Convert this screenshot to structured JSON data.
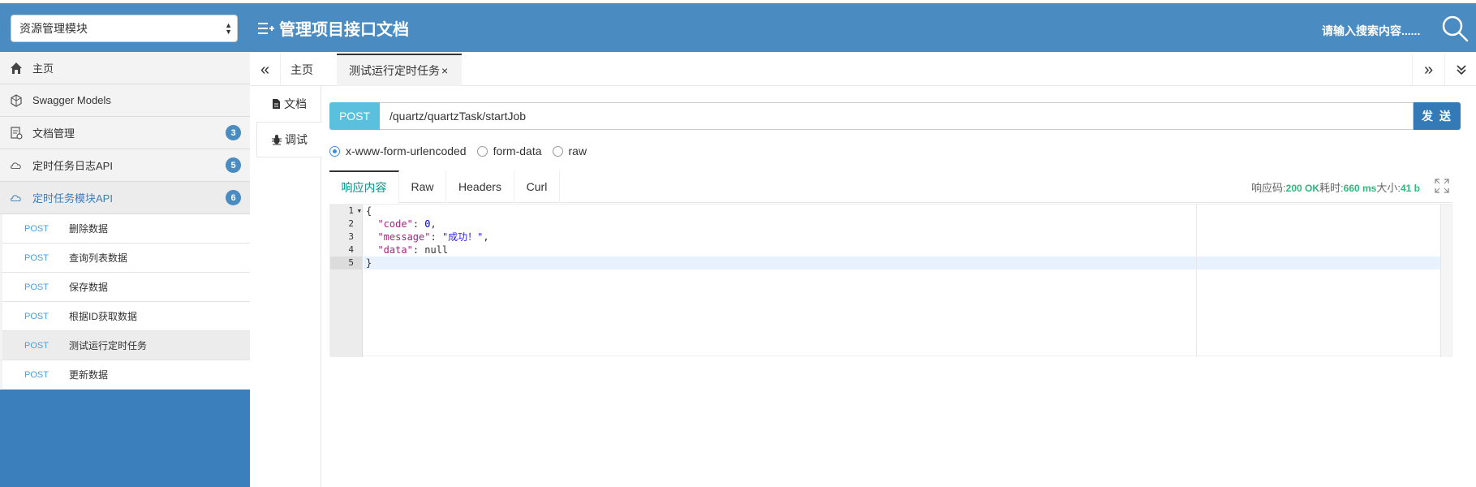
{
  "header": {
    "module_select": "资源管理模块",
    "title": "管理项目接口文档",
    "search_placeholder": "请输入搜索内容......",
    "bg_color": "#4a8bc2"
  },
  "sidebar": {
    "items": [
      {
        "label": "主页",
        "icon": "home-icon"
      },
      {
        "label": "Swagger Models",
        "icon": "models-icon"
      },
      {
        "label": "文档管理",
        "icon": "doc-manage-icon",
        "badge": "3"
      },
      {
        "label": "定时任务日志API",
        "icon": "api-cloud-icon",
        "badge": "5"
      },
      {
        "label": "定时任务模块API",
        "icon": "api-cloud-icon",
        "badge": "6"
      }
    ],
    "sub_items": [
      {
        "method": "POST",
        "label": "删除数据"
      },
      {
        "method": "POST",
        "label": "查询列表数据"
      },
      {
        "method": "POST",
        "label": "保存数据"
      },
      {
        "method": "POST",
        "label": "根据ID获取数据"
      },
      {
        "method": "POST",
        "label": "测试运行定时任务"
      },
      {
        "method": "POST",
        "label": "更新数据"
      }
    ]
  },
  "tabs": {
    "nav_left": "«",
    "home": "主页",
    "current": "测试运行定时任务",
    "close": "×",
    "nav_right": "»",
    "nav_more": "⌄"
  },
  "vtabs": {
    "doc": "文档",
    "debug": "调试"
  },
  "request": {
    "method": "POST",
    "url": "/quartz/quartzTask/startJob",
    "send": "发 送",
    "content_types": [
      "x-www-form-urlencoded",
      "form-data",
      "raw"
    ],
    "selected_content_type": "x-www-form-urlencoded"
  },
  "response": {
    "tabs": [
      "响应内容",
      "Raw",
      "Headers",
      "Curl"
    ],
    "status_label": "响应码:",
    "status_value": "200 OK",
    "time_label": "耗时:",
    "time_value": "660 ms",
    "size_label": "大小:",
    "size_value": "41 b",
    "line_numbers": [
      "1",
      "2",
      "3",
      "4",
      "5"
    ],
    "body_lines": [
      "{",
      "  \"code\": 0,",
      "  \"message\": \"成功！\",",
      "  \"data\": null",
      "}"
    ]
  }
}
